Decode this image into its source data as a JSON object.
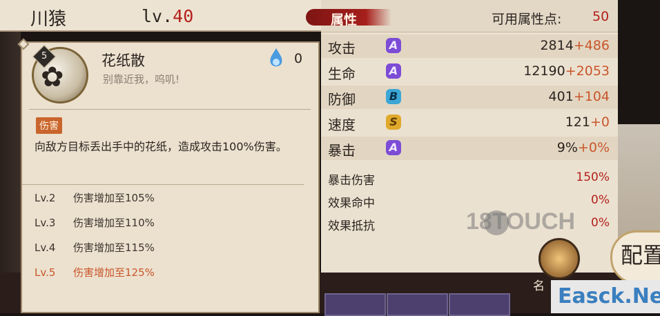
{
  "shikigami": {
    "name": "川猿",
    "level_prefix": "lv.",
    "level": "40"
  },
  "skill": {
    "level_badge": "5",
    "name": "花纸散",
    "quote": "别靠近我，呜叽!",
    "orb_cost": "0",
    "type_tag": "伤害",
    "description": "向敌方目标丢出手中的花纸，造成攻击100%伤害。",
    "upgrades": [
      {
        "level": "Lv.2",
        "text": "伤害增加至105%",
        "active": false
      },
      {
        "level": "Lv.3",
        "text": "伤害增加至110%",
        "active": false
      },
      {
        "level": "Lv.4",
        "text": "伤害增加至115%",
        "active": false
      },
      {
        "level": "Lv.5",
        "text": "伤害增加至125%",
        "active": true
      }
    ]
  },
  "attributes": {
    "tab_label": "属性",
    "points_label": "可用属性点:",
    "points_value": "50",
    "stats": [
      {
        "name": "攻击",
        "grade": "A",
        "base": "2814",
        "bonus": "+486"
      },
      {
        "name": "生命",
        "grade": "A",
        "base": "12190",
        "bonus": "+2053"
      },
      {
        "name": "防御",
        "grade": "B",
        "base": "401",
        "bonus": "+104"
      },
      {
        "name": "速度",
        "grade": "S",
        "base": "121",
        "bonus": "+0"
      },
      {
        "name": "暴击",
        "grade": "A",
        "base": "9%",
        "bonus": "+0%"
      }
    ],
    "secondary": [
      {
        "name": "暴击伤害",
        "value": "150%"
      },
      {
        "name": "效果命中",
        "value": "0%"
      },
      {
        "name": "效果抵抗",
        "value": "0%"
      }
    ]
  },
  "overlay": {
    "config_label": "配置",
    "name_fragment": "名",
    "watermark": "18TOUCH",
    "site_badge": "Easck.Net"
  }
}
